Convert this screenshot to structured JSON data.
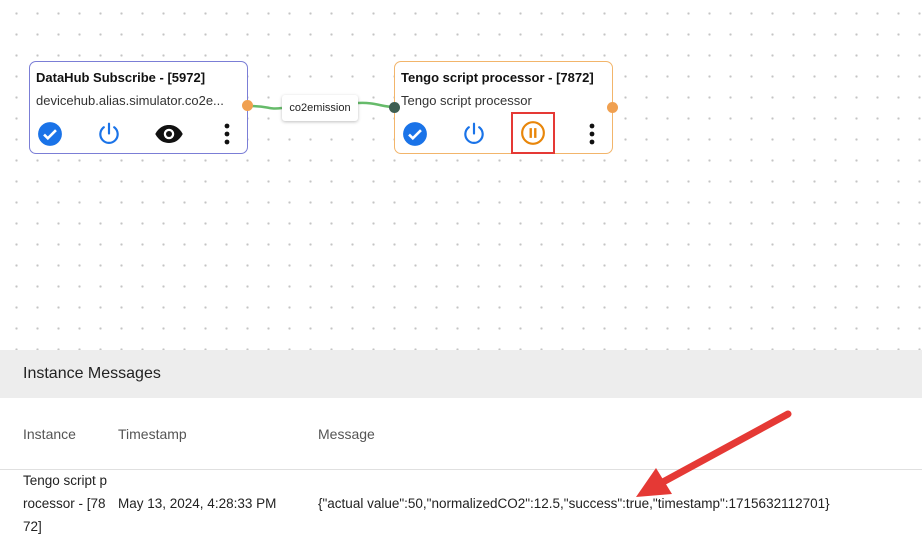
{
  "nodes": [
    {
      "title": "DataHub Subscribe - [5972]",
      "subtitle": "devicehub.alias.simulator.co2e...",
      "border_color": "#7b7ed6",
      "actions": [
        "check-circle-icon",
        "power-icon",
        "eye-icon",
        "more-vert-icon"
      ]
    },
    {
      "title": "Tengo script processor - [7872]",
      "subtitle": "Tengo script processor",
      "border_color": "#f2b56b",
      "actions": [
        "check-circle-icon",
        "power-icon",
        "pause-circle-icon",
        "more-vert-icon"
      ]
    }
  ],
  "edge": {
    "label": "co2emission"
  },
  "colors": {
    "accent_blue": "#1a73e8",
    "pause_orange": "#e8860a",
    "highlight_red": "#e53935",
    "port_orange": "#f0a050",
    "port_dark": "#3f5f52",
    "edge_green": "#66bb6a"
  },
  "panel": {
    "title": "Instance Messages",
    "columns": [
      "Instance",
      "Timestamp",
      "Message"
    ],
    "rows": [
      {
        "instance_lines": [
          "Tengo script p",
          "rocessor - [78",
          "72]"
        ],
        "timestamp": "May 13, 2024, 4:28:33 PM",
        "message": "{\"actual value\":50,\"normalizedCO2\":12.5,\"success\":true,\"timestamp\":1715632112701}"
      }
    ]
  }
}
